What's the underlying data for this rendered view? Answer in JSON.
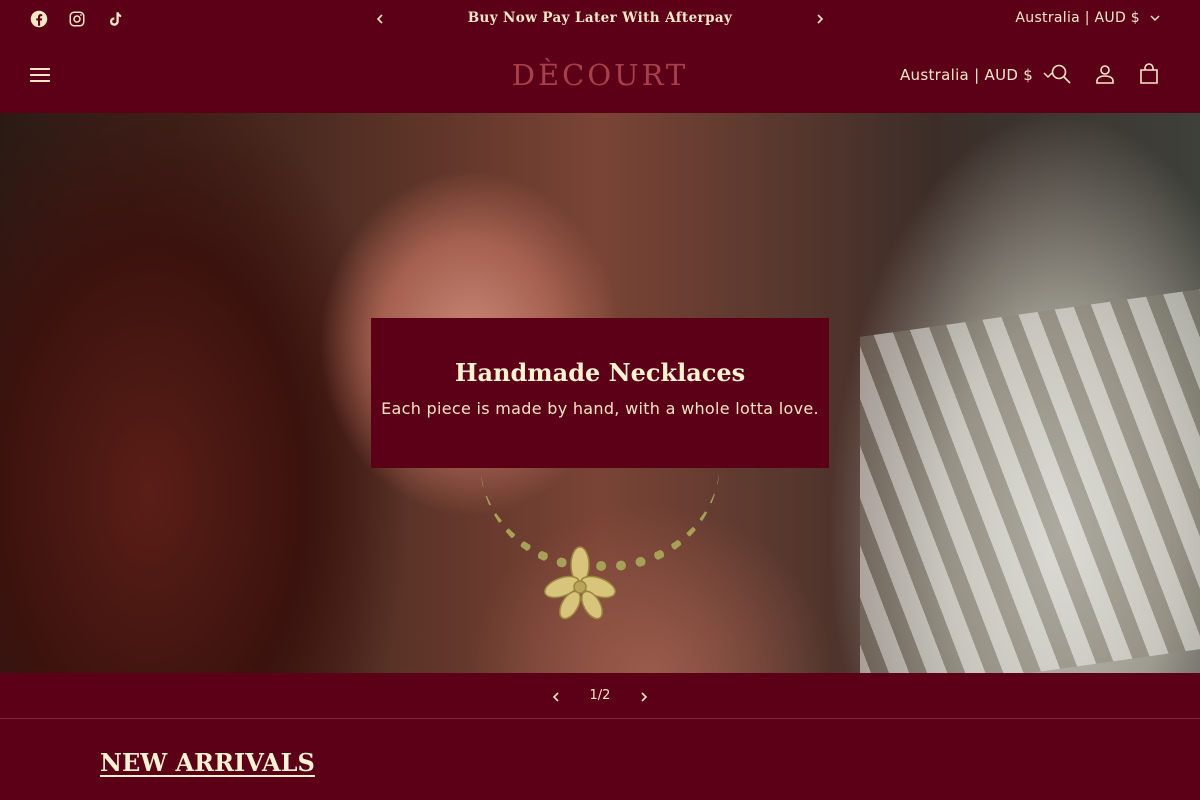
{
  "announcement": {
    "text": "Buy Now Pay Later With Afterpay",
    "locale": "Australia | AUD $"
  },
  "social": {
    "icons": [
      "facebook-icon",
      "instagram-icon",
      "tiktok-icon"
    ]
  },
  "header": {
    "logo": "DÈCOURT",
    "locale": "Australia | AUD $"
  },
  "hero": {
    "title": "Handmade Necklaces",
    "subtitle": "Each piece is made by hand, with a whole lotta love.",
    "slide_counter": "1/2"
  },
  "sections": {
    "new_arrivals_title": "NEW ARRIVALS"
  },
  "colors": {
    "background": "#5c0017",
    "text": "#f6e7c9",
    "logo": "#a8404c"
  }
}
